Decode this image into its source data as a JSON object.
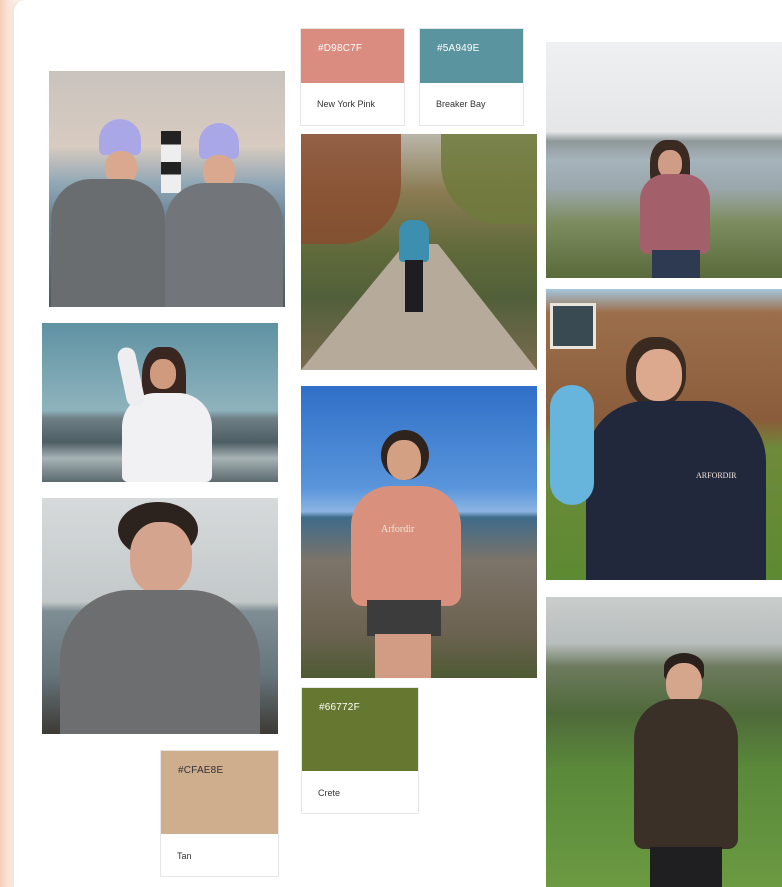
{
  "palette": [
    {
      "hex": "#D98C7F",
      "name": "New York Pink",
      "color": "#D98C7F"
    },
    {
      "hex": "#5A949E",
      "name": "Breaker Bay",
      "color": "#5A949E"
    },
    {
      "hex": "#66772F",
      "name": "Crete",
      "color": "#66772F"
    },
    {
      "hex": "#CFAE8E",
      "name": "Tan",
      "color": "#CFAE8E"
    }
  ],
  "wordmarks": {
    "pink_sweatshirt": "Arfordir",
    "navy_fleece": "ARFORDIR"
  }
}
